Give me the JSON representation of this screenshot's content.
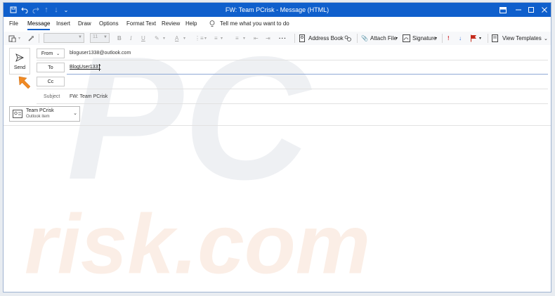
{
  "window": {
    "title": "FW: Team PCrisk  -  Message (HTML)"
  },
  "menu": {
    "tabs": [
      {
        "label": "File"
      },
      {
        "label": "Message"
      },
      {
        "label": "Insert"
      },
      {
        "label": "Draw"
      },
      {
        "label": "Options"
      },
      {
        "label": "Format Text"
      },
      {
        "label": "Review"
      },
      {
        "label": "Help"
      }
    ],
    "active_tab": "Message",
    "tell_me": "Tell me what you want to do"
  },
  "ribbon": {
    "font_size": "11",
    "address_book": "Address Book",
    "attach_file": "Attach File",
    "signature": "Signature",
    "view_templates": "View Templates"
  },
  "compose": {
    "send_label": "Send",
    "from_label": "From",
    "from_value": "bloguser1338@outlook.com",
    "to_label": "To",
    "to_value": "BlogUser1337",
    "cc_label": "Cc",
    "subject_label": "Subject",
    "subject_value": "FW: Team PCrisk",
    "attachment": {
      "name": "Team PCrisk",
      "type": "Outlook item"
    }
  },
  "watermark": {
    "line1": "PC",
    "line2": "risk.com"
  },
  "colors": {
    "accent": "#0f5fcc",
    "flag_red": "#c42b1c",
    "important_red": "#d13438",
    "arrow_orange": "#f08a24"
  }
}
